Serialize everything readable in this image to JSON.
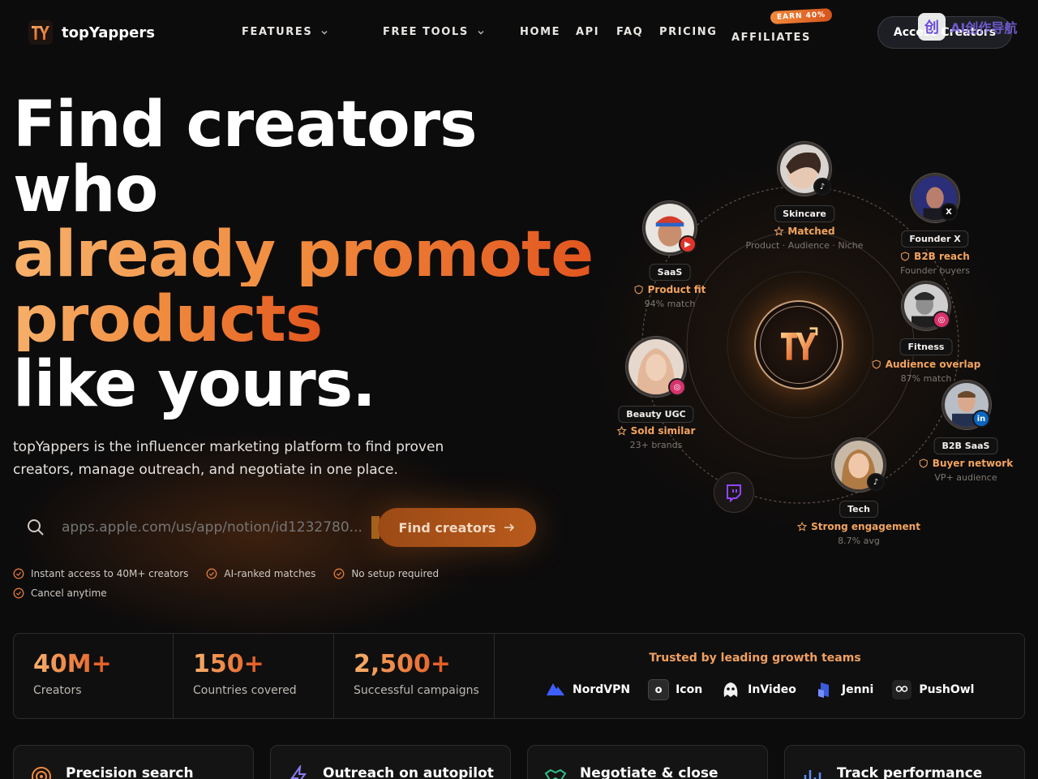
{
  "brand": {
    "name": "topYappers"
  },
  "nav": {
    "features": "FEATURES",
    "free_tools": "FREE TOOLS",
    "home": "HOME",
    "api": "API",
    "faq": "FAQ",
    "pricing": "PRICING",
    "affiliates": "AFFILIATES",
    "earn_badge": "EARN 40%",
    "access_button": "Access Creators"
  },
  "watermark": {
    "glyph": "创",
    "text": "AI创作导航"
  },
  "hero": {
    "line1": "Find creators",
    "line2": "who",
    "line3": "already promote",
    "line4": "products",
    "line5": "like yours.",
    "subtitle": "topYappers is the influencer marketing platform to find proven creators, manage outreach, and negotiate in one place.",
    "search_placeholder": "apps.apple.com/us/app/notion/id1232780...",
    "find_button": "Find creators",
    "checks": [
      "Instant access to 40M+ creators",
      "AI-ranked matches",
      "No setup required",
      "Cancel anytime"
    ]
  },
  "orbit": {
    "creators": [
      {
        "tag": "Skincare",
        "main": "Matched",
        "sub": "Product · Audience · Niche",
        "icon": "star-icon",
        "social": "tiktok-icon"
      },
      {
        "tag": "Founder X",
        "main": "B2B reach",
        "sub": "Founder buyers",
        "icon": "shield-icon",
        "social": "x-icon"
      },
      {
        "tag": "SaaS",
        "main": "Product fit",
        "sub": "94% match",
        "icon": "shield-icon",
        "social": "youtube-icon"
      },
      {
        "tag": "Fitness",
        "main": "Audience overlap",
        "sub": "87% match",
        "icon": "shield-icon",
        "social": "instagram-icon"
      },
      {
        "tag": "Beauty UGC",
        "main": "Sold similar",
        "sub": "23+ brands",
        "icon": "star-icon",
        "social": "instagram-icon"
      },
      {
        "tag": "B2B SaaS",
        "main": "Buyer network",
        "sub": "VP+ audience",
        "icon": "shield-icon",
        "social": "linkedin-icon"
      },
      {
        "tag": "Tech",
        "main": "Strong engagement",
        "sub": "8.7% avg",
        "icon": "star-icon",
        "social": "tiktok-icon"
      }
    ],
    "social_labels": {
      "x": "X",
      "linkedin": "in",
      "hub": "TY"
    }
  },
  "stats": [
    {
      "value": "40M+",
      "label": "Creators"
    },
    {
      "value": "150+",
      "label": "Countries covered"
    },
    {
      "value": "2,500+",
      "label": "Successful campaigns"
    }
  ],
  "trusted": {
    "heading": "Trusted by leading growth teams",
    "brands": [
      "NordVPN",
      "Icon",
      "InVideo",
      "Jenni",
      "PushOwl"
    ],
    "icon_glyph": "o"
  },
  "features": [
    {
      "title": "Precision search"
    },
    {
      "title": "Outreach on autopilot"
    },
    {
      "title": "Negotiate & close"
    },
    {
      "title": "Track performance"
    }
  ],
  "colors": {
    "accent": "#f08a3c",
    "accent_dark": "#e2561f",
    "background": "#0d0c0c"
  }
}
